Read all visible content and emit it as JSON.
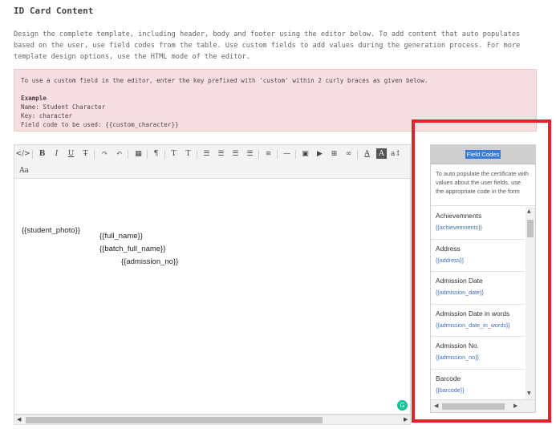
{
  "page": {
    "title": "ID Card Content",
    "description": "Design the complete template, including header, body and footer using the editor below. To add content that auto populates based on the user, use field codes from the table. Use custom fields to add values during the generation process. For more template design options, use the HTML mode of the editor."
  },
  "notice": {
    "intro": "To use a custom field in the editor, enter the key prefixed with 'custom' within 2 curly braces as given below.",
    "example_label": "Example",
    "name_line": "Name: Student Character",
    "key_line": "Key: character",
    "code_line": "Field code to be used: {{custom_character}}"
  },
  "toolbar": {
    "row1": [
      "</>",
      "B",
      "I",
      "U",
      "T̶",
      "↷",
      "↶",
      "▦",
      "¶",
      "T",
      "T",
      "☰",
      "☰",
      "☰",
      "☰",
      "≡",
      "—",
      "▣",
      "▶",
      "⊞",
      "∞",
      "A",
      "A",
      "a↕"
    ],
    "row2": [
      "Aa"
    ],
    "icons": [
      "code-view-icon",
      "bold-icon",
      "italic-icon",
      "underline-icon",
      "strikethrough-icon",
      "redo-icon",
      "undo-icon",
      "table-icon",
      "paragraph-icon",
      "font-size-icon",
      "clear-format-icon",
      "unordered-list-icon",
      "ordered-list-icon",
      "align-icon",
      "indent-icon",
      "paragraph-format-icon",
      "horizontal-line-icon",
      "image-icon",
      "video-icon",
      "embed-icon",
      "link-icon",
      "font-color-icon",
      "background-color-icon",
      "line-height-icon",
      "font-family-icon"
    ]
  },
  "editor": {
    "student_photo": "{{student_photo}}",
    "full_name": "{{full_name}}",
    "batch_full_name": "{{batch_full_name}}",
    "admission_no": "{{admission_no}}"
  },
  "field_codes": {
    "header": "Field Codes",
    "intro": "To auto populate the certificate with values about the user fields, use the appropriate code in the form",
    "items": [
      {
        "name": "Achievemnents",
        "code": "{{achievemnents}}"
      },
      {
        "name": "Address",
        "code": "{{address}}"
      },
      {
        "name": "Admission Date",
        "code": "{{admission_date}}"
      },
      {
        "name": "Admission Date in words",
        "code": "{{admission_date_in_words}}"
      },
      {
        "name": "Admission No.",
        "code": "{{admission_no}}"
      },
      {
        "name": "Barcode",
        "code": "{{barcode}}"
      }
    ]
  },
  "colors": {
    "highlight": "#e2232e",
    "notice_bg": "#f5dfe0",
    "code_text": "#3a6fc0",
    "header_selection": "#3a7bd5"
  }
}
